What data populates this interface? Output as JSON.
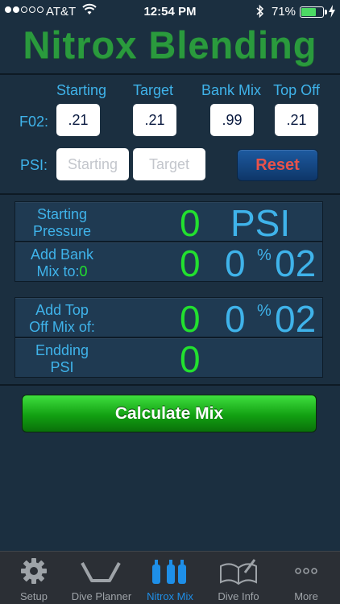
{
  "status_bar": {
    "carrier": "AT&T",
    "time": "12:54 PM",
    "battery_percent": "71%",
    "signal_bars": 2,
    "battery_level": 0.71
  },
  "app": {
    "title": "Nitrox Blending"
  },
  "inputs": {
    "columns": [
      "Starting",
      "Target",
      "Bank Mix",
      "Top Off"
    ],
    "fo2_label": "F02:",
    "fo2_values": [
      ".21",
      ".21",
      ".99",
      ".21"
    ],
    "psi_label": "PSI:",
    "psi_starting_placeholder": "Starting",
    "psi_target_placeholder": "Target",
    "reset_label": "Reset"
  },
  "results": {
    "starting_pressure": {
      "label_line1": "Starting",
      "label_line2": "Pressure",
      "value": "0",
      "unit": "PSI"
    },
    "add_bank_mix": {
      "label_line1": "Add Bank",
      "label_line2_prefix": "Mix to:",
      "label_inline_value": "0",
      "value": "0",
      "percent_value": "0",
      "percent_symbol": "%",
      "gas": "02"
    },
    "add_top_off": {
      "label_line1": "Add Top",
      "label_line2": "Off Mix of:",
      "value": "0",
      "percent_value": "0",
      "percent_symbol": "%",
      "gas": "02"
    },
    "ending_psi": {
      "label_line1": "Endding",
      "label_line2": "PSI",
      "value": "0"
    }
  },
  "calculate_label": "Calculate Mix",
  "tabs": [
    {
      "label": "Setup",
      "icon": "gear-icon",
      "active": false
    },
    {
      "label": "Dive Planner",
      "icon": "dive-profile-icon",
      "active": false
    },
    {
      "label": "Nitrox Mix",
      "icon": "tanks-icon",
      "active": true
    },
    {
      "label": "Dive Info",
      "icon": "logbook-icon",
      "active": false
    },
    {
      "label": "More",
      "icon": "more-icon",
      "active": false
    }
  ],
  "colors": {
    "background": "#1b2f40",
    "accent_blue": "#3fb3ea",
    "value_green": "#22e02f",
    "title_green": "#2a9a3d",
    "reset_red": "#e9524a",
    "tab_active": "#1e8fe8"
  }
}
